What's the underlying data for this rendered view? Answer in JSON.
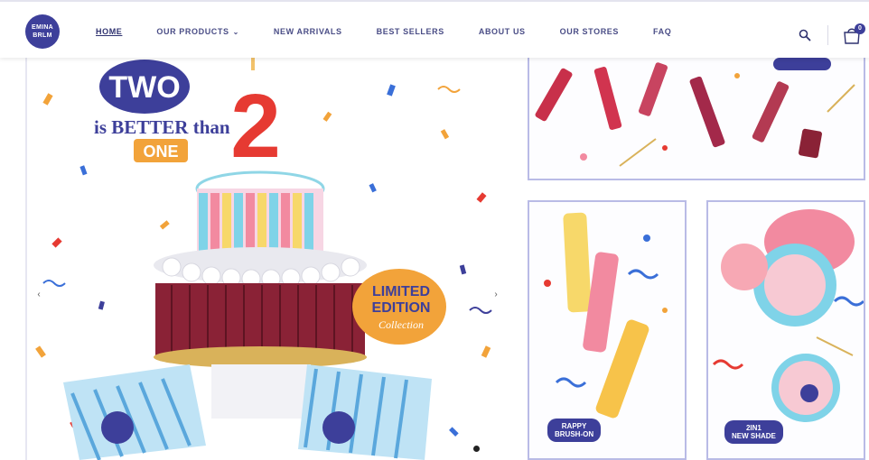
{
  "brand": {
    "logo_line1": "EMINA",
    "logo_line2": "BRLM"
  },
  "nav": {
    "items": [
      {
        "label": "HOME",
        "active": true
      },
      {
        "label": "OUR PRODUCTS",
        "dropdown": true
      },
      {
        "label": "NEW ARRIVALS"
      },
      {
        "label": "BEST SELLERS"
      },
      {
        "label": "ABOUT US"
      },
      {
        "label": "OUR STORES"
      },
      {
        "label": "FAQ"
      }
    ],
    "dropdown_caret": "⌄"
  },
  "header_icons": {
    "search": "search-icon",
    "cart": "bag-icon",
    "cart_count": "0"
  },
  "hero": {
    "headline": "TWO",
    "line2": "is BETTER than",
    "line3": "ONE",
    "candle_number": "2",
    "badge_line1": "LIMITED",
    "badge_line2": "EDITION",
    "badge_line3": "Collection",
    "arrow_left": "‹",
    "arrow_right": "›"
  },
  "tiles": {
    "bottom_left_tag_line1": "RAPPY",
    "bottom_left_tag_line2": "BRUSH-ON",
    "bottom_right_tag_line1": "2IN1",
    "bottom_right_tag_line2": "NEW SHADE"
  },
  "colors": {
    "brand_navy": "#3d3f9a",
    "accent_orange": "#f2a33a",
    "accent_red": "#e63a32",
    "accent_pink": "#f28aa0",
    "accent_blue": "#3a6fd8"
  }
}
